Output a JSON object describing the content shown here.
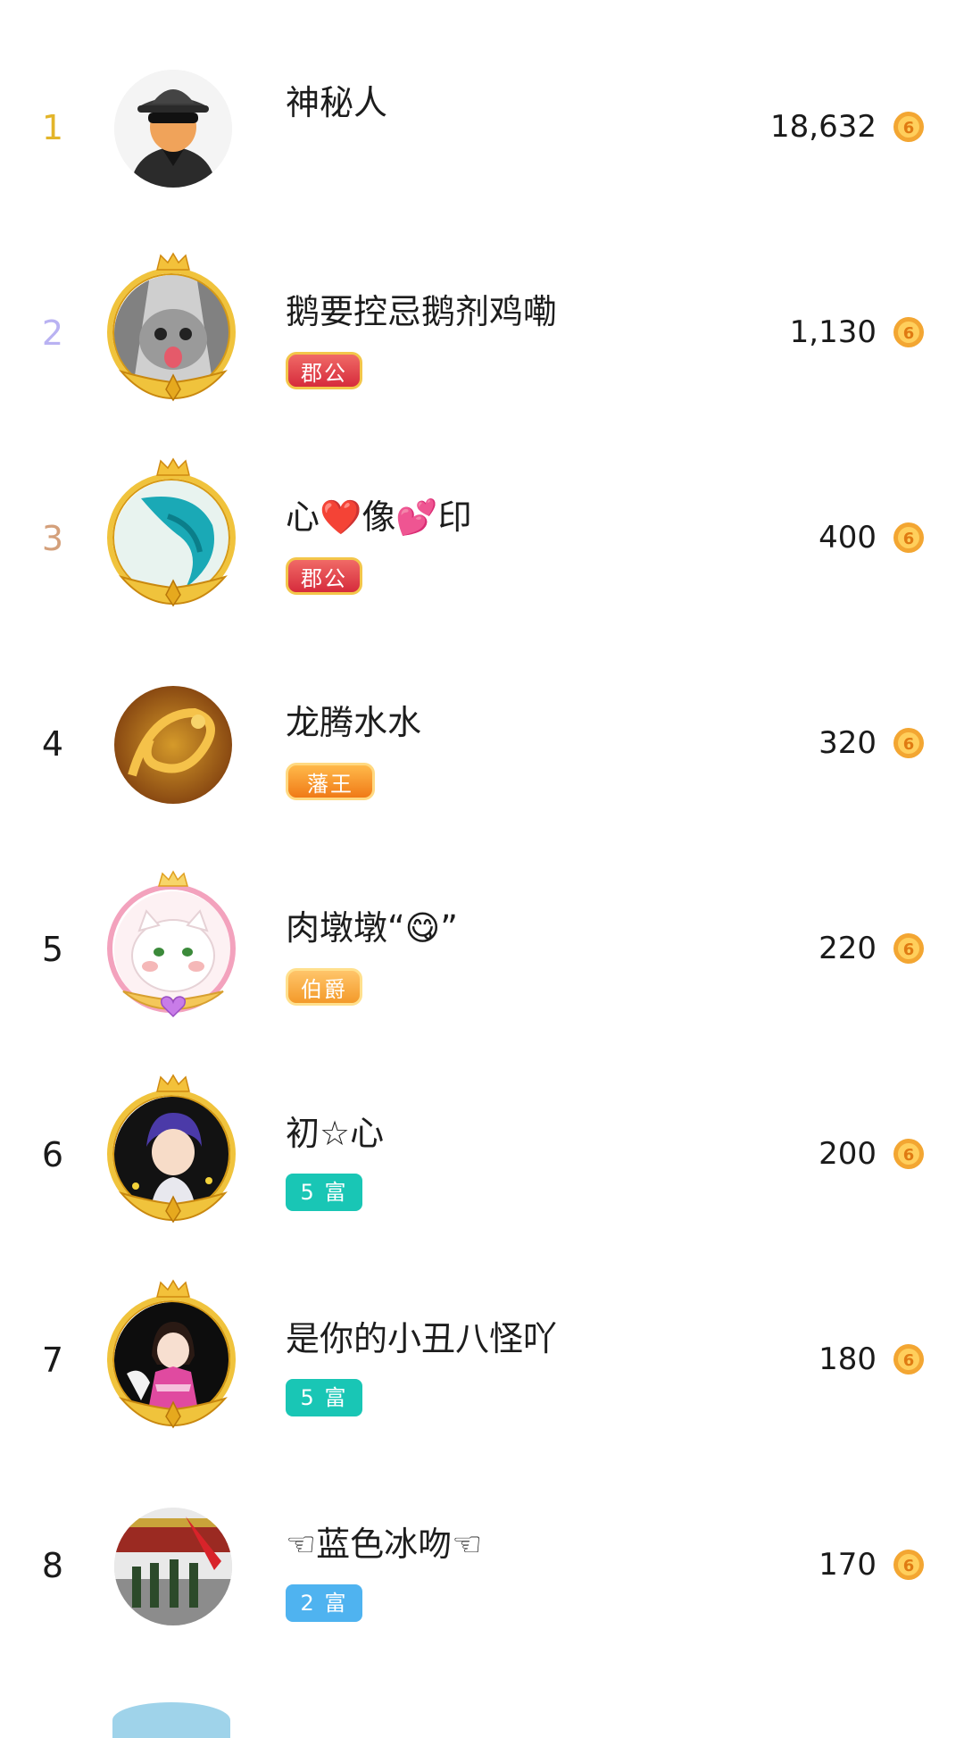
{
  "leaderboard": {
    "rows": [
      {
        "rank": "1",
        "name": "神秘人",
        "badge": "",
        "score": "18,632",
        "coin_icon": "coin-icon"
      },
      {
        "rank": "2",
        "name": "鹅要控忌鹅剂鸡嘞",
        "badge": "郡公",
        "score": "1,130",
        "coin_icon": "coin-icon"
      },
      {
        "rank": "3",
        "name": "心❤️像💕印",
        "badge": "郡公",
        "score": "400",
        "coin_icon": "coin-icon"
      },
      {
        "rank": "4",
        "name": "龙腾水水",
        "badge": "藩王",
        "score": "320",
        "coin_icon": "coin-icon"
      },
      {
        "rank": "5",
        "name": "肉墩墩“😋”",
        "badge": "伯爵",
        "score": "220",
        "coin_icon": "coin-icon"
      },
      {
        "rank": "6",
        "name": "初☆心",
        "badge": "5 富",
        "score": "200",
        "coin_icon": "coin-icon"
      },
      {
        "rank": "7",
        "name": "是你的小丑八怪吖",
        "badge": "5 富",
        "score": "180",
        "coin_icon": "coin-icon"
      },
      {
        "rank": "8",
        "name": "☜蓝色冰吻☜",
        "badge": "2 富",
        "score": "170",
        "coin_icon": "coin-icon"
      }
    ]
  },
  "colors": {
    "rank_1": "#e3b52a",
    "rank_2": "#b9b2f2",
    "rank_3": "#d4a07b",
    "coin": "#f3a632",
    "badge_junggong": "#d62b3c",
    "badge_fanwang": "#f07a17",
    "badge_bojue": "#f39a2a",
    "badge_fu5": "#19c6b5",
    "badge_fu2": "#4fb3f0"
  }
}
